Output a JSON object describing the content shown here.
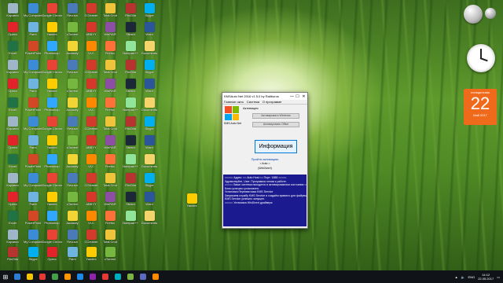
{
  "window": {
    "title": "KMSAuto Net 2016 v1.5.0 by Ratiborus",
    "minimize": "—",
    "maximize": "☐",
    "close": "✕",
    "menu": [
      "Главное окно",
      "Система",
      "О программе"
    ],
    "logo_caption": "KMS Auto Net",
    "activation_label": "Активация",
    "activate_windows": "Активировать Windows",
    "activate_office": "Активировать Office",
    "info_button": "Информация",
    "link": "Пройти активацию",
    "link2": "= Auto =",
    "mode": "(WinDivert)",
    "console": [
      "=====  Адрес:  == Auto Host ==  Порт:  1688  =====",
      "Здравствуйте, User. Программа готова к работе.",
      "",
      "===== Ваше система находится в активированном состоянии =====",
      "",
      "Ключ успешно установлен.",
      "Установка Перехватчика KMS Service",
      "Запускаем службу KMS Service и создаём правило для файрвола",
      "KMS Service успешно запущен.",
      "",
      "===== Установка WinDivert драйвера"
    ]
  },
  "gadgets": {
    "calendar_weekday": "понедельник",
    "calendar_day": "22",
    "calendar_month": "Май 2017"
  },
  "taskbar": {
    "time": "14:12",
    "date": "22.05.2017",
    "lang": "ENG",
    "apps": [
      "#2d7dd2",
      "#f5c400",
      "#e53935",
      "#43a047",
      "#ff9800",
      "#1e88e5",
      "#8e24aa",
      "#e53935",
      "#00acc1",
      "#7cb342",
      "#5c6bc0",
      "#fb8c00"
    ]
  },
  "desktop_icons": [
    {
      "label": "Корзина",
      "color": "#9fb6c8"
    },
    {
      "label": "My Computer",
      "color": "#3b8bd6"
    },
    {
      "label": "Google Chrome",
      "color": "#e94335"
    },
    {
      "label": "Recuva",
      "color": "#4a7ab8"
    },
    {
      "label": "CCleaner",
      "color": "#d23b2b"
    },
    {
      "label": "Total Cmd",
      "color": "#f0c43a"
    },
    {
      "label": "FileZilla",
      "color": "#b6332f"
    },
    {
      "label": "Skype",
      "color": "#00aff0"
    },
    {
      "label": "Opera",
      "color": "#e2232a"
    },
    {
      "label": "Paint",
      "color": "#6fb3e0"
    },
    {
      "label": "Yandex",
      "color": "#ffcc00"
    },
    {
      "label": "uTorrent",
      "color": "#76b83f"
    },
    {
      "label": "ABBYY",
      "color": "#d6372b"
    },
    {
      "label": "WinRAR",
      "color": "#8c4fa3"
    },
    {
      "label": "Steam",
      "color": "#1b2838"
    },
    {
      "label": "Word",
      "color": "#2b579a"
    },
    {
      "label": "Excel",
      "color": "#217346"
    },
    {
      "label": "PowerPoint",
      "color": "#d24726"
    },
    {
      "label": "Photoshop",
      "color": "#31a8ff"
    },
    {
      "label": "Audacity",
      "color": "#f3d435"
    },
    {
      "label": "VLC",
      "color": "#ff8800"
    },
    {
      "label": "Firefox",
      "color": "#ff7139"
    },
    {
      "label": "Notepad++",
      "color": "#90e59a"
    },
    {
      "label": "Documents",
      "color": "#f4d46b"
    }
  ]
}
